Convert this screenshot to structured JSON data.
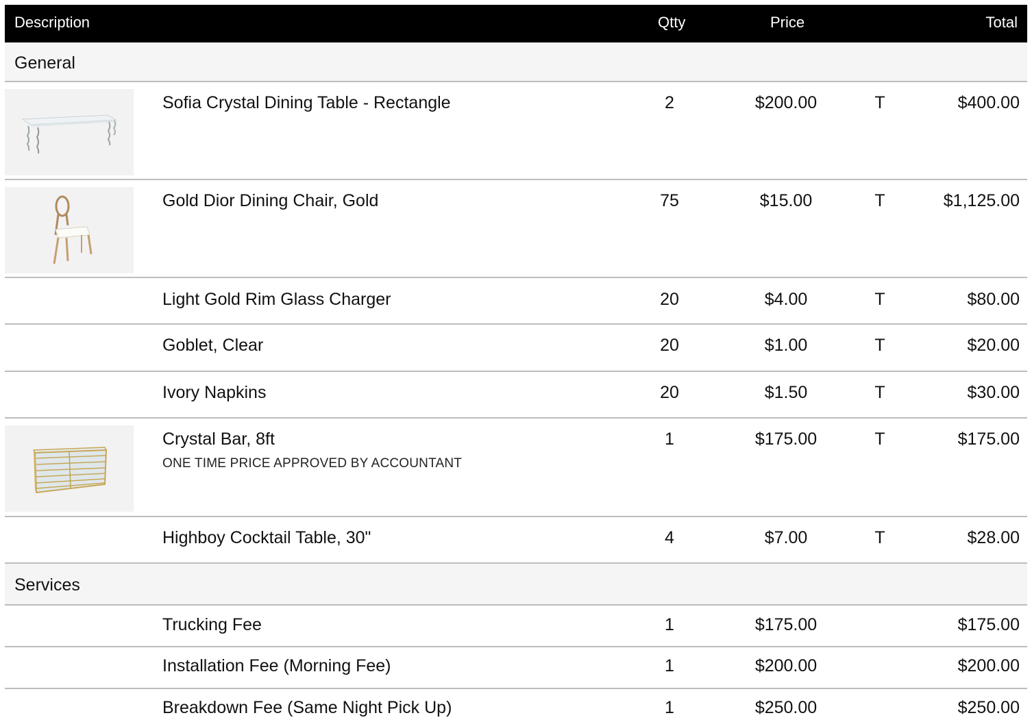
{
  "header": {
    "description": "Description",
    "qty": "Qtty",
    "price": "Price",
    "total": "Total"
  },
  "sections": [
    {
      "name": "General",
      "items": [
        {
          "description": "Sofia Crystal Dining Table - Rectangle",
          "qty": "2",
          "price": "$200.00",
          "tax": "T",
          "total": "$400.00",
          "image": "crystal-table-icon"
        },
        {
          "description": "Gold Dior Dining Chair, Gold",
          "qty": "75",
          "price": "$15.00",
          "tax": "T",
          "total": "$1,125.00",
          "image": "dior-chair-icon"
        },
        {
          "description": "Light Gold Rim Glass Charger",
          "qty": "20",
          "price": "$4.00",
          "tax": "T",
          "total": "$80.00"
        },
        {
          "description": "Goblet, Clear",
          "qty": "20",
          "price": "$1.00",
          "tax": "T",
          "total": "$20.00"
        },
        {
          "description": "Ivory Napkins",
          "qty": "20",
          "price": "$1.50",
          "tax": "T",
          "total": "$30.00"
        },
        {
          "description": "Crystal Bar, 8ft",
          "note": "ONE TIME PRICE APPROVED BY ACCOUNTANT",
          "qty": "1",
          "price": "$175.00",
          "tax": "T",
          "total": "$175.00",
          "image": "crystal-bar-icon"
        },
        {
          "description": "Highboy Cocktail Table, 30\"",
          "qty": "4",
          "price": "$7.00",
          "tax": "T",
          "total": "$28.00"
        }
      ]
    },
    {
      "name": "Services",
      "items": [
        {
          "description": "Trucking Fee",
          "qty": "1",
          "price": "$175.00",
          "tax": "",
          "total": "$175.00"
        },
        {
          "description": "Installation Fee (Morning Fee)",
          "qty": "1",
          "price": "$200.00",
          "tax": "",
          "total": "$200.00"
        },
        {
          "description": "Breakdown Fee (Same Night Pick Up)",
          "qty": "1",
          "price": "$250.00",
          "tax": "",
          "total": "$250.00"
        }
      ]
    }
  ],
  "colors": {
    "header_bg": "#000000",
    "header_text": "#ffffff",
    "section_bg": "#f5f5f5",
    "divider": "#bdbdbd"
  }
}
